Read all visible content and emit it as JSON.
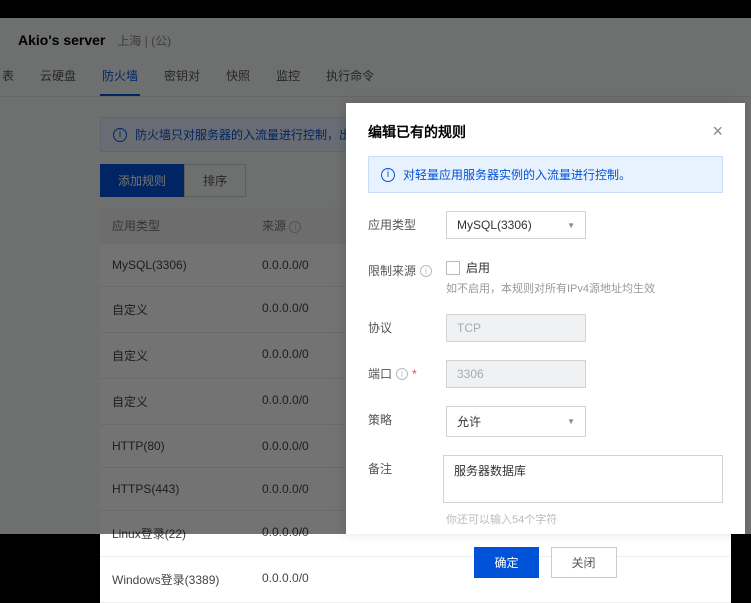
{
  "header": {
    "server_name": "Akio's server",
    "region": "上海 | (公)"
  },
  "tabs": [
    "表",
    "云硬盘",
    "防火墙",
    "密钥对",
    "快照",
    "监控",
    "执行命令"
  ],
  "active_tab_index": 2,
  "bg_notice": "防火墙只对服务器的入流量进行控制，出流量默",
  "buttons": {
    "add_rule": "添加规则",
    "sort": "排序"
  },
  "table": {
    "headers": {
      "type": "应用类型",
      "source": "来源"
    },
    "rows": [
      {
        "type": "MySQL(3306)",
        "source": "0.0.0.0/0"
      },
      {
        "type": "自定义",
        "source": "0.0.0.0/0"
      },
      {
        "type": "自定义",
        "source": "0.0.0.0/0"
      },
      {
        "type": "自定义",
        "source": "0.0.0.0/0"
      },
      {
        "type": "HTTP(80)",
        "source": "0.0.0.0/0"
      },
      {
        "type": "HTTPS(443)",
        "source": "0.0.0.0/0"
      },
      {
        "type": "Linux登录(22)",
        "source": "0.0.0.0/0"
      },
      {
        "type": "Windows登录(3389)",
        "source": "0.0.0.0/0"
      }
    ]
  },
  "modal": {
    "title": "编辑已有的规则",
    "notice": "对轻量应用服务器实例的入流量进行控制。",
    "labels": {
      "app_type": "应用类型",
      "source_limit": "限制来源",
      "enable": "启用",
      "source_hint": "如不启用，本规则对所有IPv4源地址均生效",
      "protocol": "协议",
      "port": "端口",
      "policy": "策略",
      "remark": "备注"
    },
    "values": {
      "app_type": "MySQL(3306)",
      "protocol": "TCP",
      "port": "3306",
      "policy": "允许",
      "remark": "服务器数据库"
    },
    "char_hint": "你还可以输入54个字符",
    "buttons": {
      "ok": "确定",
      "cancel": "关闭"
    }
  }
}
